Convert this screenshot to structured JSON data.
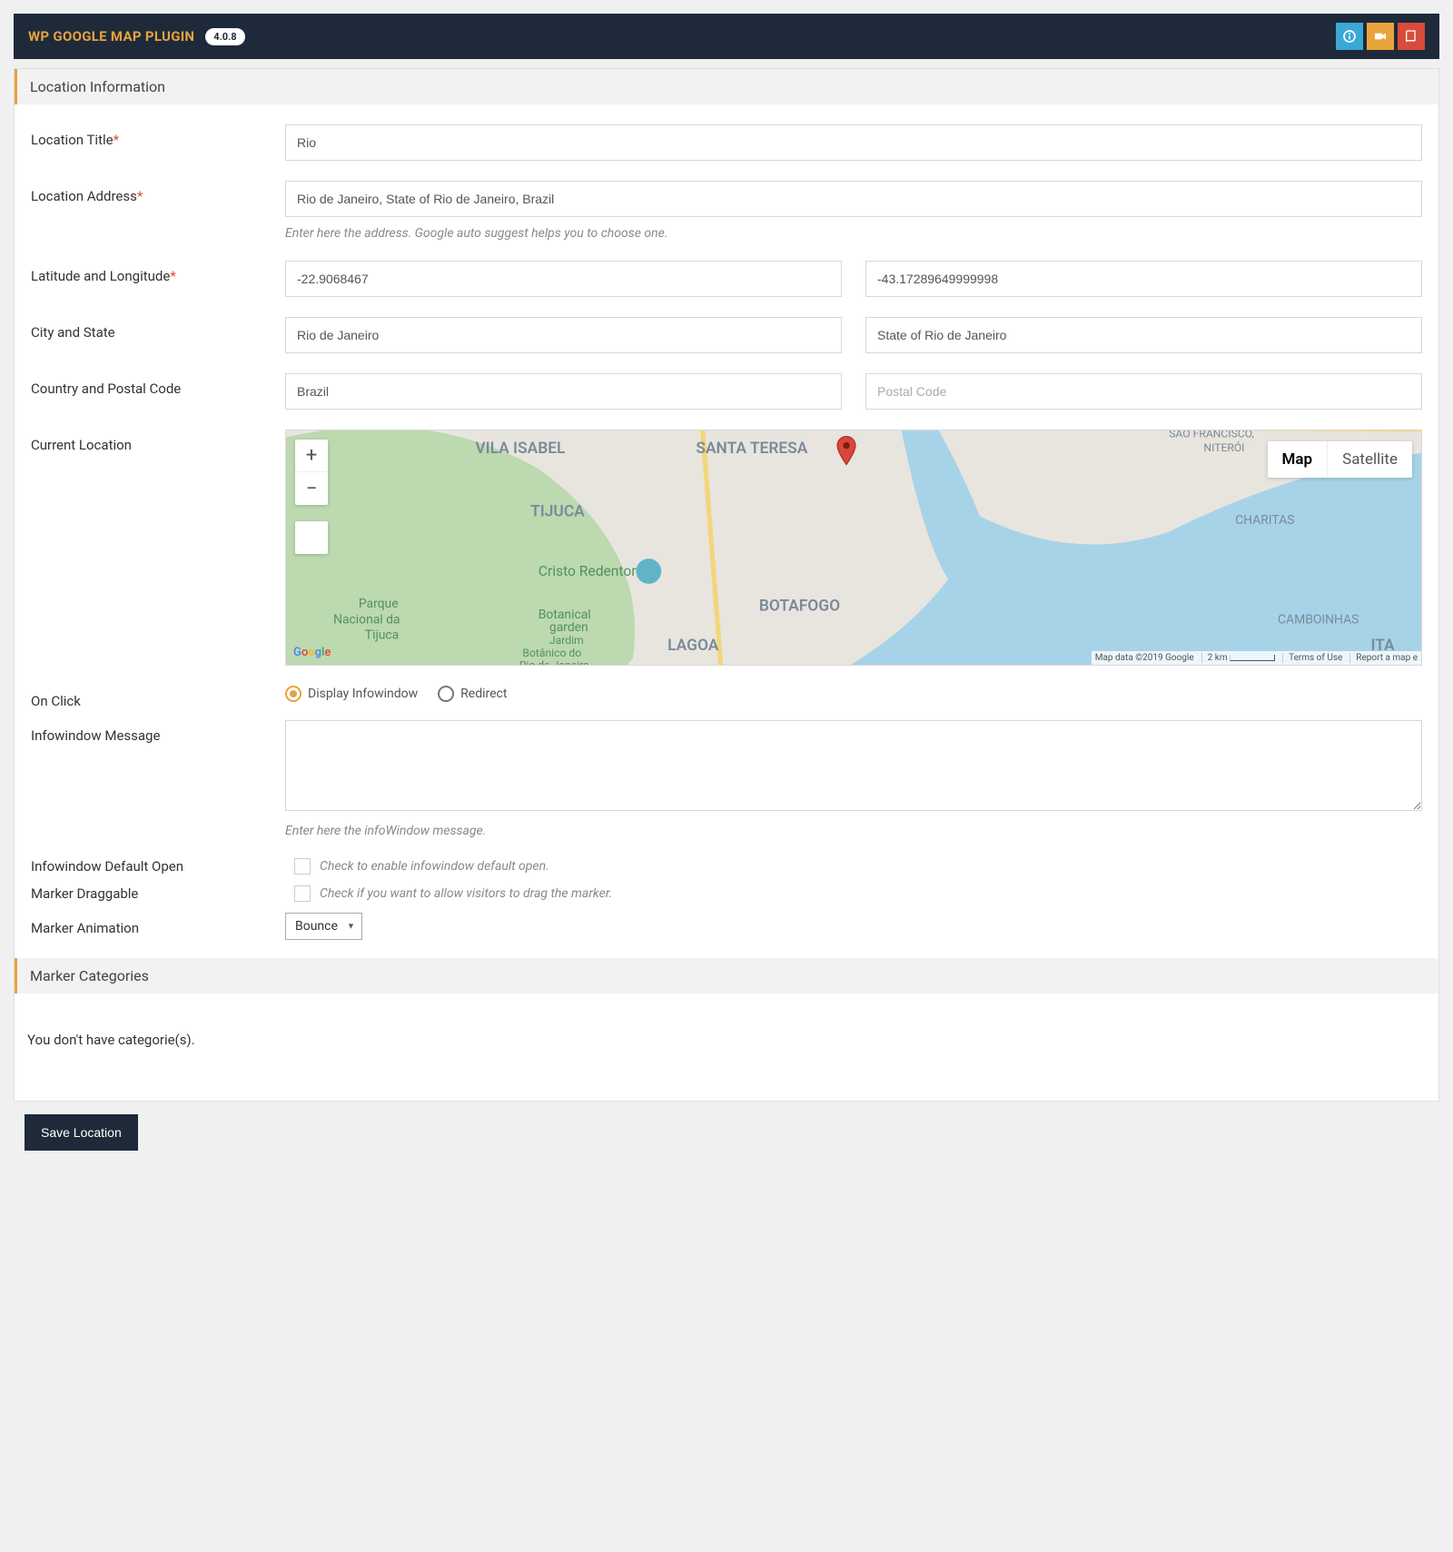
{
  "header": {
    "title": "WP GOOGLE MAP PLUGIN",
    "version": "4.0.8"
  },
  "section1": {
    "title": "Location Information"
  },
  "labels": {
    "location_title": "Location Title",
    "location_address": "Location Address",
    "latlng": "Latitude and Longitude",
    "city_state": "City and State",
    "country_postal": "Country and Postal Code",
    "current_location": "Current Location",
    "on_click": "On Click",
    "infowindow_msg": "Infowindow Message",
    "infowindow_default": "Infowindow Default Open",
    "marker_draggable": "Marker Draggable",
    "marker_animation": "Marker Animation"
  },
  "values": {
    "title": "Rio",
    "address": "Rio de Janeiro, State of Rio de Janeiro, Brazil",
    "lat": "-22.9068467",
    "lng": "-43.17289649999998",
    "city": "Rio de Janeiro",
    "state": "State of Rio de Janeiro",
    "country": "Brazil",
    "postal_ph": "Postal Code",
    "infowindow_msg": "",
    "animation": "Bounce"
  },
  "helpers": {
    "address": "Enter here the address. Google auto suggest helps you to choose one.",
    "infowindow": "Enter here the infoWindow message.",
    "default_open": "Check to enable infowindow default open.",
    "draggable": "Check if you want to allow visitors to drag the marker."
  },
  "onclick": {
    "opt1": "Display Infowindow",
    "opt2": "Redirect"
  },
  "map": {
    "btn_map": "Map",
    "btn_sat": "Satellite",
    "attr_data": "Map data ©2019 Google",
    "attr_scale": "2 km",
    "attr_terms": "Terms of Use",
    "attr_report": "Report a map e"
  },
  "section2": {
    "title": "Marker Categories"
  },
  "no_categories": "You don't have categorie(s).",
  "save_label": "Save Location"
}
